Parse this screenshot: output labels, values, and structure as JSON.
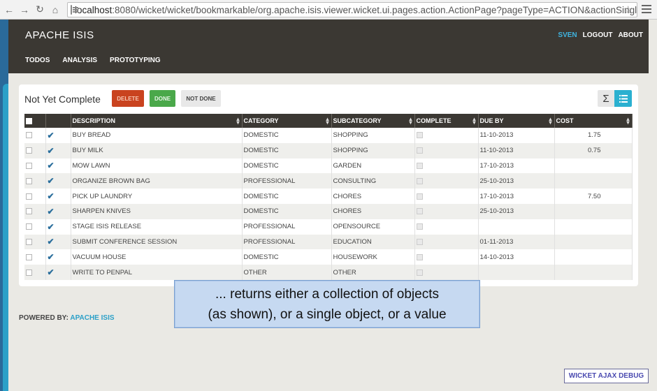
{
  "browser": {
    "url_host": "localhost",
    "url_rest": ":8080/wicket/wicket/bookmarkable/org.apache.isis.viewer.wicket.ui.pages.action.ActionPage?pageType=ACTION&actionSingleResults"
  },
  "header": {
    "app_title": "APACHE ISIS",
    "user": "SVEN",
    "logout": "LOGOUT",
    "about": "ABOUT",
    "menu": [
      "TODOS",
      "ANALYSIS",
      "PROTOTYPING"
    ]
  },
  "panel": {
    "title": "Not Yet Complete",
    "buttons": {
      "delete": "DELETE",
      "done": "DONE",
      "not_done": "NOT DONE"
    },
    "summary_icon": "Σ"
  },
  "table": {
    "columns": [
      "DESCRIPTION",
      "CATEGORY",
      "SUBCATEGORY",
      "COMPLETE",
      "DUE BY",
      "COST"
    ],
    "rows": [
      {
        "description": "BUY BREAD",
        "category": "DOMESTIC",
        "subcategory": "SHOPPING",
        "due_by": "11-10-2013",
        "cost": "1.75"
      },
      {
        "description": "BUY MILK",
        "category": "DOMESTIC",
        "subcategory": "SHOPPING",
        "due_by": "11-10-2013",
        "cost": "0.75"
      },
      {
        "description": "MOW LAWN",
        "category": "DOMESTIC",
        "subcategory": "GARDEN",
        "due_by": "17-10-2013",
        "cost": ""
      },
      {
        "description": "ORGANIZE BROWN BAG",
        "category": "PROFESSIONAL",
        "subcategory": "CONSULTING",
        "due_by": "25-10-2013",
        "cost": ""
      },
      {
        "description": "PICK UP LAUNDRY",
        "category": "DOMESTIC",
        "subcategory": "CHORES",
        "due_by": "17-10-2013",
        "cost": "7.50"
      },
      {
        "description": "SHARPEN KNIVES",
        "category": "DOMESTIC",
        "subcategory": "CHORES",
        "due_by": "25-10-2013",
        "cost": ""
      },
      {
        "description": "STAGE ISIS RELEASE",
        "category": "PROFESSIONAL",
        "subcategory": "OPENSOURCE",
        "due_by": "",
        "cost": ""
      },
      {
        "description": "SUBMIT CONFERENCE SESSION",
        "category": "PROFESSIONAL",
        "subcategory": "EDUCATION",
        "due_by": "01-11-2013",
        "cost": ""
      },
      {
        "description": "VACUUM HOUSE",
        "category": "DOMESTIC",
        "subcategory": "HOUSEWORK",
        "due_by": "14-10-2013",
        "cost": ""
      },
      {
        "description": "WRITE TO PENPAL",
        "category": "OTHER",
        "subcategory": "OTHER",
        "due_by": "",
        "cost": ""
      }
    ]
  },
  "callout": {
    "line1": "... returns either a collection of objects",
    "line2": "(as shown), or a single object, or a value"
  },
  "footer": {
    "powered_by": "POWERED BY:",
    "powered_link": "APACHE ISIS",
    "wicket_debug": "WICKET AJAX DEBUG"
  },
  "colors": {
    "header_bg": "#3b3833",
    "accent_blue": "#2ba0c8",
    "delete_red": "#c9431f",
    "done_green": "#4aa84a",
    "callout_bg": "#c6d9f1"
  }
}
